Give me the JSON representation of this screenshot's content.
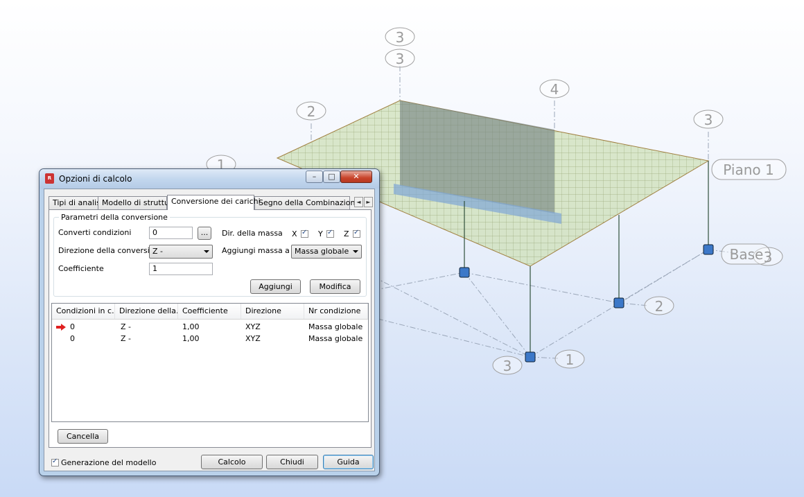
{
  "model_view": {
    "level_labels": [
      "Piano 1",
      "Base"
    ],
    "grid_markers": [
      "3",
      "3",
      "2",
      "4",
      "3",
      "1",
      "3",
      "2",
      "3",
      "1"
    ]
  },
  "dialog": {
    "title": "Opzioni di calcolo",
    "app_icon": "robot-app-icon",
    "window_buttons": [
      "minimize-icon",
      "maximize-icon",
      "close-icon"
    ],
    "tabs": [
      {
        "label": "Tipi di analisi"
      },
      {
        "label": "Modello di struttura"
      },
      {
        "label": "Conversione dei carichi"
      },
      {
        "label": "Segno della Combinazione"
      }
    ],
    "active_tab": "Conversione dei carichi",
    "group": {
      "legend": "Parametri della conversione",
      "converti_label": "Converti condizioni",
      "converti_value": "0",
      "browse_label": "...",
      "direzione_label": "Direzione della conversione",
      "direzione_value": "Z -",
      "coefficiente_label": "Coefficiente",
      "coefficiente_value": "1",
      "dir_massa_label": "Dir. della massa",
      "axis_x": "X",
      "axis_y": "Y",
      "axis_z": "Z",
      "x_checked": true,
      "y_checked": true,
      "z_checked": true,
      "aggiungi_massa_label": "Aggiungi massa a",
      "aggiungi_massa_value": "Massa globale",
      "aggiungi_button": "Aggiungi",
      "modifica_button": "Modifica"
    },
    "table": {
      "columns": [
        "Condizioni in c...",
        "Direzione della...",
        "Coefficiente",
        "Direzione",
        "Nr condizione"
      ],
      "rows": [
        {
          "condizioni": "0",
          "direzione": "Z -",
          "coefficiente": "1,00",
          "dir_massa": "XYZ",
          "nr": "Massa globale",
          "current": true
        },
        {
          "condizioni": "0",
          "direzione": "Z -",
          "coefficiente": "1,00",
          "dir_massa": "XYZ",
          "nr": "Massa globale",
          "current": false
        }
      ]
    },
    "cancella_button": "Cancella",
    "footer": {
      "generazione_label": "Generazione del modello",
      "generazione_checked": true,
      "calcolo_button": "Calcolo",
      "chiudi_button": "Chiudi",
      "guida_button": "Guida"
    }
  }
}
